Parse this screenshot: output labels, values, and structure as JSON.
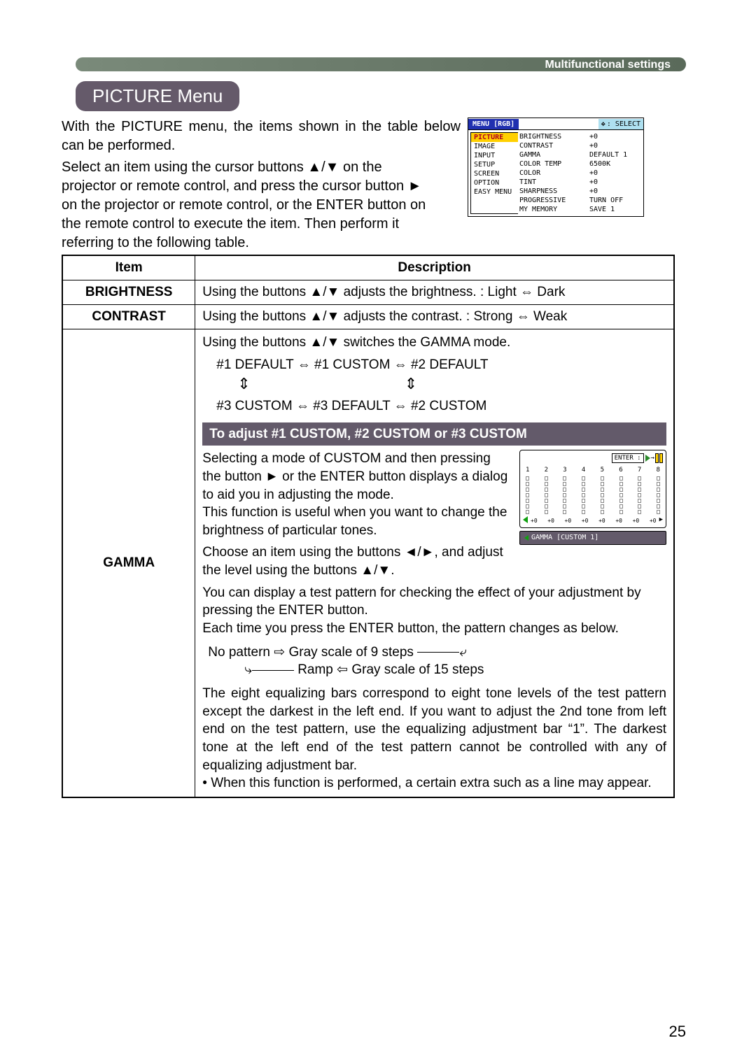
{
  "header": {
    "section_label": "Multifunctional settings"
  },
  "title": "PICTURE Menu",
  "intro": {
    "p1": "With the PICTURE menu, the items shown in the table below can be performed.",
    "p2": "Select an item using the cursor buttons ▲/▼ on the projector or remote control, and press the cursor button ► on the projector or remote control, or the ENTER button on the remote control to execute the item. Then perform it referring to the following table."
  },
  "osd": {
    "menu_label": "MENU [RGB]",
    "select_label": ": SELECT",
    "tabs": [
      "PICTURE",
      "IMAGE",
      "INPUT",
      "SETUP",
      "SCREEN",
      "OPTION",
      "EASY MENU"
    ],
    "items": [
      {
        "name": "BRIGHTNESS",
        "value": "+0"
      },
      {
        "name": "CONTRAST",
        "value": "+0"
      },
      {
        "name": "GAMMA",
        "value": "DEFAULT 1"
      },
      {
        "name": "COLOR TEMP",
        "value": "6500K"
      },
      {
        "name": "COLOR",
        "value": "+0"
      },
      {
        "name": "TINT",
        "value": "+0"
      },
      {
        "name": "SHARPNESS",
        "value": "+0"
      },
      {
        "name": "PROGRESSIVE",
        "value": "TURN OFF"
      },
      {
        "name": "MY MEMORY",
        "value": "SAVE 1"
      }
    ]
  },
  "table": {
    "headers": {
      "item": "Item",
      "desc": "Description"
    },
    "rows": {
      "brightness": {
        "item": "BRIGHTNESS",
        "desc": "Using the buttons ▲/▼ adjusts the brightness. :    Light ⇔ Dark"
      },
      "contrast": {
        "item": "CONTRAST",
        "desc": "Using the buttons ▲/▼ adjusts the contrast. :    Strong ⇔ Weak"
      },
      "gamma": {
        "item": "GAMMA",
        "top_line": "Using the buttons ▲/▼ switches the GAMMA mode.",
        "cycle_top": "#1 DEFAULT ⇔ #1 CUSTOM ⇔ #2 DEFAULT",
        "cycle_bottom": "#3 CUSTOM ⇔ #3 DEFAULT ⇔ #2 CUSTOM",
        "banner": "To adjust #1 CUSTOM, #2 CUSTOM or #3 CUSTOM",
        "custom_p1": "Selecting a mode of CUSTOM and then pressing the button ► or the ENTER button displays a dialog to aid you in adjusting the mode.",
        "custom_p2": "This function is useful when you want to change the brightness of particular tones.",
        "custom_p3": "Choose an item using the buttons ◄/►, and adjust the level using the buttons ▲/▼.",
        "custom_p4": "You can display a test pattern for checking the effect of your adjustment by pressing the ENTER button.",
        "custom_p5": "Each time you press the ENTER button, the pattern changes as below.",
        "pattern_line1": "No pattern ⇨ Gray scale of 9 steps ",
        "pattern_line2": "Ramp ⇦ Gray scale of 15 steps",
        "eq_para": "The eight equalizing bars correspond to eight tone levels of the test pattern except the darkest in the left end. If you want to adjust the 2nd tone from left end on the test pattern, use the equalizing adjustment bar “1”. The darkest tone at the left end of the test pattern cannot be controlled with any of equalizing adjustment bar.",
        "eq_note": "• When this function is performed, a certain extra such as a line may appear.",
        "fig": {
          "enter": "ENTER :",
          "nums": [
            "1",
            "2",
            "3",
            "4",
            "5",
            "6",
            "7",
            "8"
          ],
          "vals": [
            "+0",
            "+0",
            "+0",
            "+0",
            "+0",
            "+0",
            "+0",
            "+0"
          ],
          "label": "GAMMA [CUSTOM 1]"
        }
      }
    }
  },
  "page_number": "25"
}
